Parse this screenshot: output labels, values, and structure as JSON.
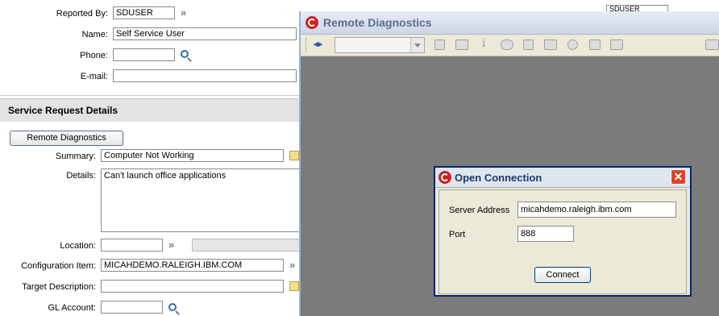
{
  "form": {
    "reported_by_label": "Reported By:",
    "reported_by_value": "SDUSER",
    "name_label": "Name:",
    "name_value": "Self Service User",
    "phone_label": "Phone:",
    "phone_value": "",
    "email_label": "E-mail:",
    "email_value": "",
    "section_title": "Service Request Details",
    "remote_button": "Remote Diagnostics",
    "summary_label": "Summary:",
    "summary_value": "Computer Not Working",
    "details_label": "Details:",
    "details_value": "Can't launch office applications",
    "location_label": "Location:",
    "location_value": "",
    "config_label": "Configuration Item:",
    "config_value": "MICAHDEMO.RALEIGH.IBM.COM",
    "target_label": "Target Description:",
    "target_value": "",
    "gl_label": "GL Account:",
    "gl_value": "",
    "hidden_field_value": "SDUSER"
  },
  "window": {
    "title": "Remote Diagnostics",
    "toolbar_icons": [
      "nav-arrows-icon",
      "mouse-icon",
      "keyboard-icon",
      "info-icon",
      "chat-icon",
      "users-icon",
      "toolbox-icon",
      "record-icon",
      "document-icon",
      "document-settings-icon"
    ]
  },
  "dialog": {
    "title": "Open Connection",
    "server_label": "Server Address",
    "server_value": "micahdemo.raleigh.ibm.com",
    "port_label": "Port",
    "port_value": "888",
    "connect_button": "Connect"
  }
}
